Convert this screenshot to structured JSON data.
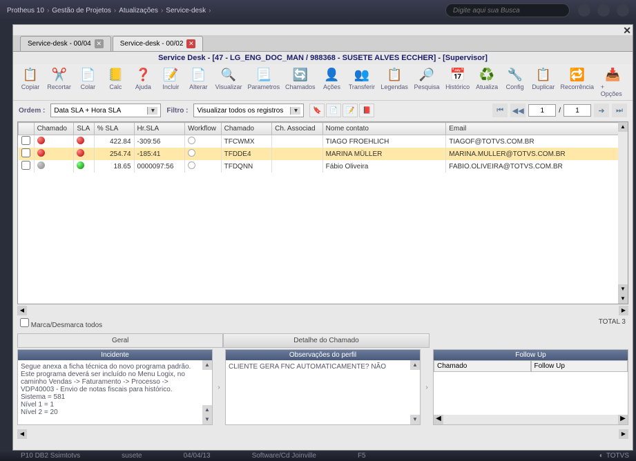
{
  "breadcrumb": [
    "Protheus 10",
    "Gestão de Projetos",
    "Atualizações",
    "Service-desk"
  ],
  "search_placeholder": "Digite aqui sua Busca",
  "tabs": [
    {
      "label": "Service-desk - 00/04"
    },
    {
      "label": "Service-desk - 00/02"
    }
  ],
  "window_title": "Service Desk - [47 - LG_ENG_DOC_MAN / 988368 - SUSETE ALVES ECCHER] - [Supervisor]",
  "toolbar": [
    {
      "label": "Copiar",
      "icon": "📋"
    },
    {
      "label": "Recortar",
      "icon": "✂️"
    },
    {
      "label": "Colar",
      "icon": "📄"
    },
    {
      "label": "Calc",
      "icon": "📒"
    },
    {
      "label": "Ajuda",
      "icon": "❓"
    },
    {
      "label": "Incluir",
      "icon": "📝"
    },
    {
      "label": "Alterar",
      "icon": "📄"
    },
    {
      "label": "Visualizar",
      "icon": "🔍"
    },
    {
      "label": "Parametros",
      "icon": "📃"
    },
    {
      "label": "Chamados",
      "icon": "🔄"
    },
    {
      "label": "Ações",
      "icon": "👤"
    },
    {
      "label": "Transferir",
      "icon": "👥"
    },
    {
      "label": "Legendas",
      "icon": "📋"
    },
    {
      "label": "Pesquisa",
      "icon": "🔎"
    },
    {
      "label": "Histórico",
      "icon": "📅"
    },
    {
      "label": "Atualiza",
      "icon": "♻️"
    },
    {
      "label": "Config",
      "icon": "🔧"
    },
    {
      "label": "Duplicar",
      "icon": "📋"
    },
    {
      "label": "Recorrência",
      "icon": "🔁"
    },
    {
      "label": "+ Opções",
      "icon": "📥"
    }
  ],
  "ordem_label": "Ordem :",
  "ordem_value": "Data SLA + Hora SLA",
  "filtro_label": "Filtro :",
  "filtro_value": "Visualizar todos os registros",
  "page_current": "1",
  "page_total": "1",
  "columns": [
    "",
    "Chamado",
    "SLA",
    "% SLA",
    "Hr.SLA",
    "Workflow",
    "Chamado",
    "Ch. Associad",
    "Nome contato",
    "Email"
  ],
  "rows": [
    {
      "sla": "red",
      "pct": "422.84",
      "hr": "-309:56",
      "wf": "white",
      "chamado": "TFCWMX",
      "assoc": "",
      "nome": "TIAGO FROEHLICH",
      "email": "TIAGOF@TOTVS.COM.BR",
      "selected": false
    },
    {
      "sla": "red",
      "pct": "254.74",
      "hr": "-185:41",
      "wf": "white",
      "chamado": "TFDDE4",
      "assoc": "",
      "nome": "MARINA MÜLLER",
      "email": "MARINA.MULLER@TOTVS.COM.BR",
      "selected": true
    },
    {
      "sla": "gray",
      "sla2": "green",
      "pct": "18.65",
      "hr": "0000097:56",
      "wf": "white",
      "chamado": "TFDQNN",
      "assoc": "",
      "nome": "Fábio Oliveira",
      "email": "FABIO.OLIVEIRA@TOTVS.COM.BR",
      "selected": false
    }
  ],
  "check_all": "Marca/Desmarca todos",
  "total_label": "TOTAL 3",
  "detail_tabs": [
    "Geral",
    "Detalhe do Chamado"
  ],
  "panel_incidente": {
    "title": "Incidente",
    "body": "Segue anexa a ficha técnica do novo programa padrão.\nEste programa deverá ser incluído no Menu Logix, no caminho Vendas -> Faturamento -> Processo -> VDP40003 - Envio de notas fiscais para histórico.\nSistema = 581\nNível 1 = 1\nNível 2 = 20"
  },
  "panel_obs": {
    "title": "Observações do perfil",
    "body": "CLIENTE GERA FNC AUTOMATICAMENTE? NÃO"
  },
  "panel_followup": {
    "title": "Follow Up",
    "cols": [
      "Chamado",
      "Follow Up"
    ]
  },
  "status": {
    "db": "P10 DB2 Ssimtotvs",
    "user": "susete",
    "date": "04/04/13",
    "env": "Software/Cd Joinville",
    "key": "F5",
    "brand": "TOTVS"
  }
}
